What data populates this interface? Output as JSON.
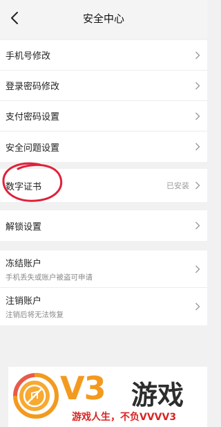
{
  "header": {
    "title": "安全中心"
  },
  "groups": {
    "account": {
      "items": [
        {
          "label": "手机号修改"
        },
        {
          "label": "登录密码修改"
        },
        {
          "label": "支付密码设置"
        },
        {
          "label": "安全问题设置"
        }
      ]
    },
    "certificate": {
      "label": "数字证书",
      "value": "已安装"
    },
    "unlock": {
      "label": "解锁设置"
    },
    "danger": {
      "items": [
        {
          "label": "冻结账户",
          "subtitle": "手机丢失或账户被盗可申请"
        },
        {
          "label": "注销账户",
          "subtitle": "注销后将无法恢复"
        }
      ]
    }
  },
  "watermark": {
    "brand": "V3",
    "name": "游戏",
    "slogan": "游戏人生，不负VVVV3"
  },
  "colors": {
    "background": "#f1f1f1",
    "card": "#ffffff",
    "annotation_circle": "#e0203a",
    "brand_orange": "#f39a1e",
    "slogan_red": "#d82424"
  }
}
